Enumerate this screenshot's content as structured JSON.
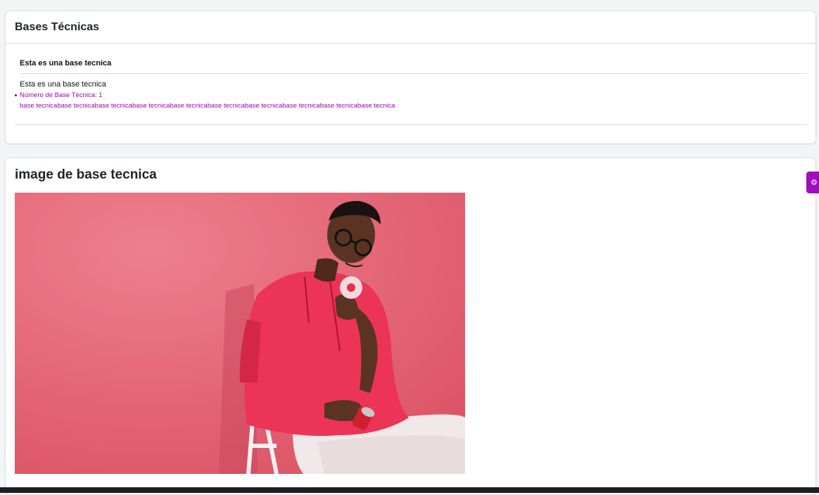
{
  "card_bases": {
    "title": "Bases Técnicas",
    "item_heading": "Esta es una base tecnica",
    "item_text": "Esta es una base tecnica",
    "number_label": "Número de Base Técnica: 1",
    "description": "base tecnicabase tecnicabase tecnicabase tecnicabase tecnicabase tecnicabase tecnicabase tecnicabase tecnicabase tecnica"
  },
  "card_image": {
    "title": "image de base tecnica",
    "photo_alt": "image de base tecnica"
  },
  "side_tab": {
    "icon": "settings-icon"
  },
  "colors": {
    "accent": "#a000b6",
    "side_tab": "#a10dc0",
    "photo_background": "#e8707f",
    "hoodie": "#ec3456"
  }
}
